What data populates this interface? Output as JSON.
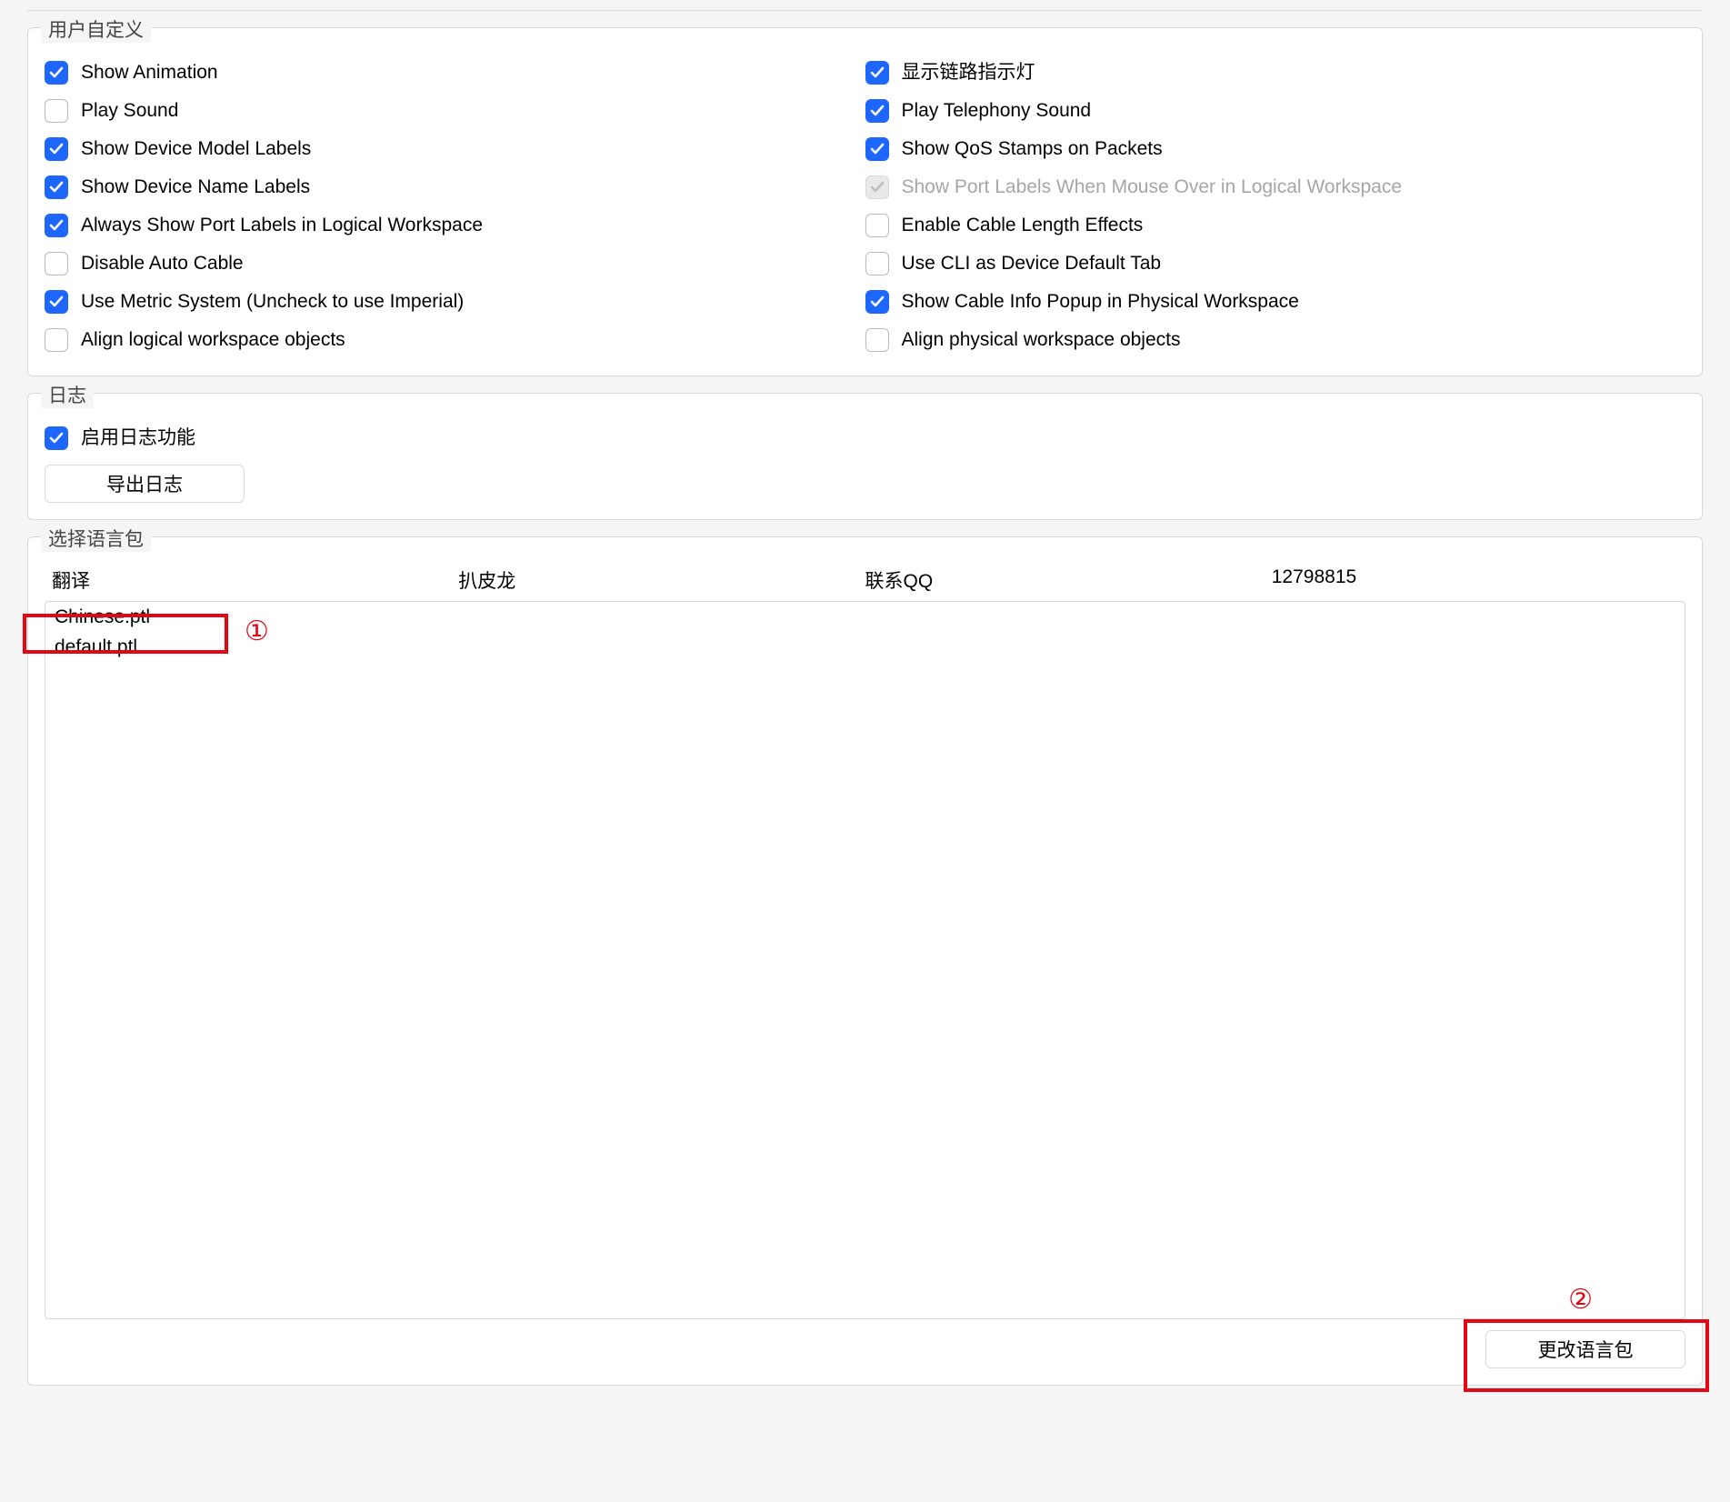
{
  "fieldsets": {
    "user_custom_legend": "用户自定义",
    "log_legend": "日志",
    "lang_legend": "选择语言包"
  },
  "options_left": [
    {
      "label": "Show Animation",
      "checked": true,
      "disabled": false
    },
    {
      "label": "Play Sound",
      "checked": false,
      "disabled": false
    },
    {
      "label": "Show Device Model Labels",
      "checked": true,
      "disabled": false
    },
    {
      "label": "Show Device Name Labels",
      "checked": true,
      "disabled": false
    },
    {
      "label": "Always Show Port Labels in Logical Workspace",
      "checked": true,
      "disabled": false
    },
    {
      "label": "Disable Auto Cable",
      "checked": false,
      "disabled": false
    },
    {
      "label": "Use Metric System (Uncheck to use Imperial)",
      "checked": true,
      "disabled": false
    },
    {
      "label": "Align logical workspace objects",
      "checked": false,
      "disabled": false
    }
  ],
  "options_right": [
    {
      "label": "显示链路指示灯",
      "checked": true,
      "disabled": false
    },
    {
      "label": "Play Telephony Sound",
      "checked": true,
      "disabled": false
    },
    {
      "label": "Show QoS Stamps on Packets",
      "checked": true,
      "disabled": false
    },
    {
      "label": "Show Port Labels When Mouse Over in Logical Workspace",
      "checked": true,
      "disabled": true
    },
    {
      "label": "Enable Cable Length Effects",
      "checked": false,
      "disabled": false
    },
    {
      "label": "Use CLI as Device Default Tab",
      "checked": false,
      "disabled": false
    },
    {
      "label": "Show Cable Info Popup in Physical Workspace",
      "checked": true,
      "disabled": false
    },
    {
      "label": "Align physical workspace objects",
      "checked": false,
      "disabled": false
    }
  ],
  "log": {
    "enable_label": "启用日志功能",
    "enable_checked": true,
    "export_button": "导出日志"
  },
  "lang": {
    "headers": [
      "翻译",
      "扒皮龙",
      "联系QQ",
      "12798815"
    ],
    "items": [
      "Chinese.ptl",
      "default.ptl"
    ],
    "change_button": "更改语言包"
  },
  "annotations": {
    "one": "①",
    "two": "②"
  }
}
